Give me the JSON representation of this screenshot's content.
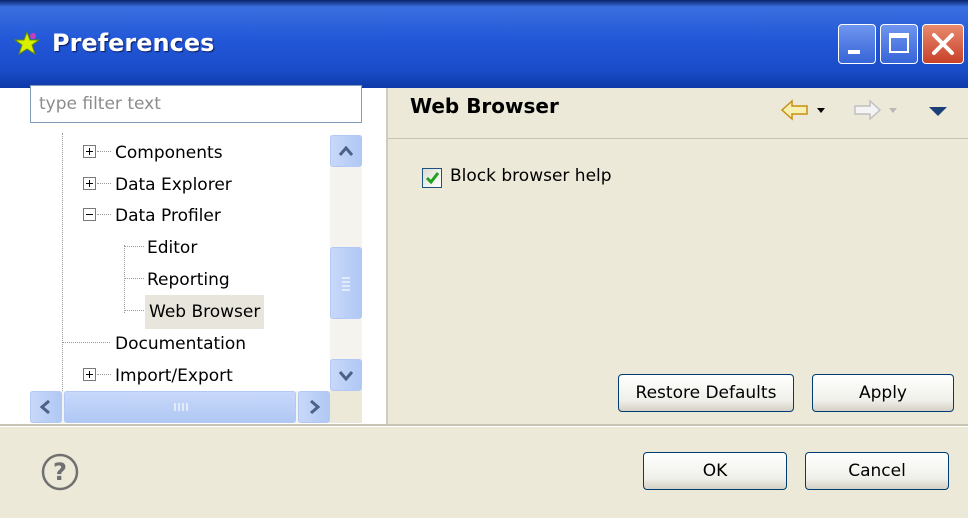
{
  "window": {
    "title": "Preferences",
    "controls": {
      "minimize": "minimize-icon",
      "maximize": "maximize-icon",
      "close": "close-icon"
    }
  },
  "filter": {
    "placeholder": "type filter text",
    "value": ""
  },
  "tree": {
    "items": [
      {
        "label": "Components",
        "state": "collapsed"
      },
      {
        "label": "Data Explorer",
        "state": "collapsed"
      },
      {
        "label": "Data Profiler",
        "state": "expanded"
      },
      {
        "label": "Editor",
        "state": "leaf"
      },
      {
        "label": "Reporting",
        "state": "leaf"
      },
      {
        "label": "Web Browser",
        "state": "leaf",
        "selected": true
      },
      {
        "label": "Documentation",
        "state": "leaf"
      },
      {
        "label": "Import/Export",
        "state": "collapsed"
      }
    ]
  },
  "page": {
    "title": "Web Browser",
    "nav": {
      "back": "back-arrow-icon",
      "forward": "forward-arrow-icon",
      "menu": "view-menu-icon"
    },
    "options": {
      "block_browser_help": {
        "label": "Block browser help",
        "checked": true
      }
    },
    "restore_defaults_label": "Restore Defaults",
    "apply_label": "Apply"
  },
  "footer": {
    "help": "help-icon",
    "ok_label": "OK",
    "cancel_label": "Cancel"
  },
  "colors": {
    "title_bar": "#2257d8",
    "dialog_bg": "#ece9d8",
    "back_arrow": "#f0c020",
    "check": "#21a121",
    "close_button": "#c8412a"
  }
}
